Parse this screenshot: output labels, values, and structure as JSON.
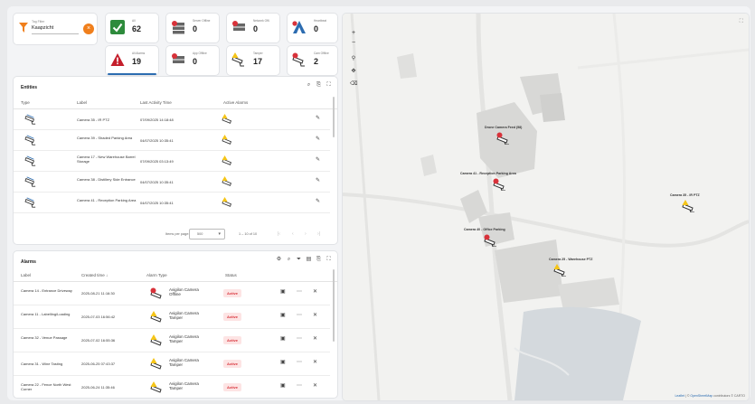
{
  "filter": {
    "label": "Tag Filter",
    "value": "Kaapzicht"
  },
  "kpis": [
    {
      "label": "All",
      "value": "62",
      "icon": "check-box-icon"
    },
    {
      "label": "Server Offline",
      "value": "0",
      "icon": "server-offline-icon"
    },
    {
      "label": "Network Offl.",
      "value": "0",
      "icon": "network-offline-icon"
    },
    {
      "label": "Heartbeat",
      "value": "0",
      "icon": "heartbeat-icon"
    },
    {
      "label": "All Alarms",
      "value": "19",
      "icon": "warning-icon"
    },
    {
      "label": "App Offline",
      "value": "0",
      "icon": "app-offline-icon"
    },
    {
      "label": "Tamper",
      "value": "17",
      "icon": "camera-tamper-icon"
    },
    {
      "label": "Cam Offline",
      "value": "2",
      "icon": "camera-offline-icon"
    }
  ],
  "entities": {
    "title": "Entities",
    "headers": {
      "type": "Type",
      "label": "Label",
      "last_activity": "Last Activity Time",
      "active_alarms": "Active Alarms"
    },
    "rows": [
      {
        "label": "Camera 35 - IR PTZ",
        "time": "07/09/2025 14:18:48"
      },
      {
        "label": "Camera 39 - Shaded Parking Area",
        "time": "04/07/2025 10:35:41"
      },
      {
        "label": "Camera 17 - New Warehouse Barrel Storage",
        "time": "07/09/2025 03:13:49"
      },
      {
        "label": "Camera 38 - Distillery Side Entrance",
        "time": "04/07/2025 10:35:41"
      },
      {
        "label": "Camera 41 - Reception Parking Area",
        "time": "04/07/2025 10:35:41"
      }
    ],
    "pager": {
      "items_label": "Items per page:",
      "page_size": "500",
      "range": "1 – 10 of 10"
    }
  },
  "alarms": {
    "title": "Alarms",
    "headers": {
      "label": "Label",
      "created": "Created time ↓",
      "type": "Alarm Type",
      "status": "Status"
    },
    "rows": [
      {
        "label": "Camera 14 - Entrance Driveway",
        "created": "2025-08-21 11:16:30",
        "type": "Avigilon Camera Offline",
        "status": "Active"
      },
      {
        "label": "Camera 11 - Labelling/Loading",
        "created": "2025-07-03 16:56:42",
        "type": "Avigilon Camera Tamper",
        "status": "Active"
      },
      {
        "label": "Camera 32 - Venue Passage",
        "created": "2025-07-02 16:55:36",
        "type": "Avigilon Camera Tamper",
        "status": "Active"
      },
      {
        "label": "Camera 31 - Wine Tasting",
        "created": "2025-06-25 07:43:37",
        "type": "Avigilon Camera Tamper",
        "status": "Active"
      },
      {
        "label": "Camera 22 - Fence North West Corner",
        "created": "2025-06-24 11:35:46",
        "type": "Avigilon Camera Tamper",
        "status": "Active"
      }
    ]
  },
  "map": {
    "markers": [
      {
        "label": "Drone Camera Feed (58)",
        "state": "offline"
      },
      {
        "label": "Camera 41 - Reception Parking Area",
        "state": "offline"
      },
      {
        "label": "Camera 35 - IR PTZ",
        "state": "tamper"
      },
      {
        "label": "Camera 40 - Office Parking",
        "state": "offline"
      },
      {
        "label": "Camera 25 - Warehouse PTZ",
        "state": "tamper"
      }
    ],
    "attribution_leaflet": "Leaflet",
    "attribution_sep": " | © ",
    "attribution_osm": "OpenStreetMap",
    "attribution_rest": " contributors © CARTO"
  }
}
